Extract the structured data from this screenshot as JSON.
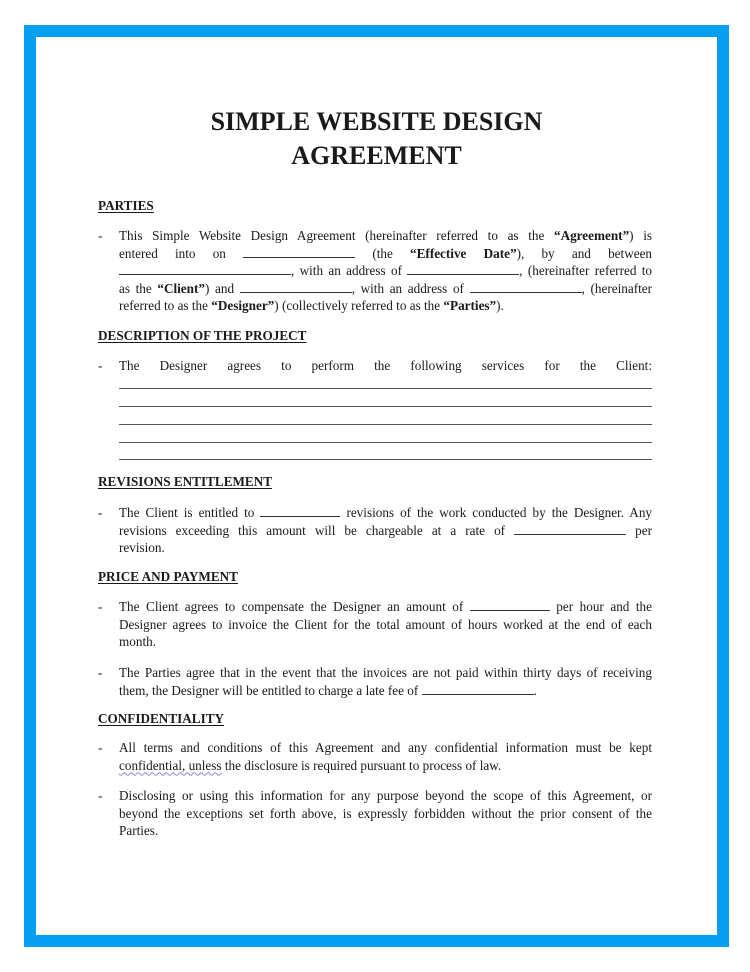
{
  "document": {
    "title_line1": "SIMPLE WEBSITE DESIGN",
    "title_line2": "AGREEMENT",
    "frame_color": "#049ff0",
    "sections": {
      "parties": {
        "heading": "PARTIES",
        "item": {
          "l1a": "This Simple Website Design Agreement (hereinafter referred to as the ",
          "l1b": "“Agreement”",
          "l1c": ") is",
          "l2a": "entered into on",
          "l2b": "(the",
          "l2c": "“Effective Date”",
          "l2d": "), by and between",
          "l3a": ", with an address of",
          "l3b": ", (hereinafter referred to",
          "l4a": "as the ",
          "l4b": "“Client”",
          "l4c": ") and",
          "l4d": ", with an address of",
          "l4e": ", (hereinafter",
          "l5a": "referred to as the ",
          "l5b": "“Designer”",
          "l5c": ") (collectively referred to as the ",
          "l5d": "“Parties”",
          "l5e": ")."
        }
      },
      "description": {
        "heading": "DESCRIPTION OF THE PROJECT",
        "item": "The Designer agrees to perform the following services for the Client:",
        "blank_lines": 5
      },
      "revisions": {
        "heading": "REVISIONS ENTITLEMENT",
        "l1a": "The Client is entitled to",
        "l1b": "revisions of the work conducted by the Designer. Any",
        "l2a": "revisions exceeding this amount will be chargeable at a rate of",
        "l2b": "per",
        "l3": "revision."
      },
      "price": {
        "heading": "PRICE AND PAYMENT",
        "item1": {
          "l1a": "The Client agrees to compensate the Designer an amount of",
          "l1b": "per hour and the",
          "l2": "Designer agrees to invoice the Client for the total amount of hours worked at the end of each",
          "l3": "month."
        },
        "item2": {
          "l1": "The Parties agree that in the event that the invoices are not paid within thirty days of receiving",
          "l2a": "them, the Designer will be entitled to charge a late fee of",
          "l2b": "."
        }
      },
      "confidentiality": {
        "heading": "CONFIDENTIALITY",
        "item1": {
          "l1": "All terms and conditions of this Agreement and any confidential information must be kept",
          "l2a": "confidential, unless",
          "l2b": " the disclosure is required pursuant to process of law."
        },
        "item2": {
          "l1": "Disclosing or using this information for any purpose beyond the scope of this Agreement, or",
          "l2": "beyond the exceptions set forth above, is expressly forbidden without the prior consent of the",
          "l3": "Parties."
        }
      }
    },
    "dash": "-"
  }
}
